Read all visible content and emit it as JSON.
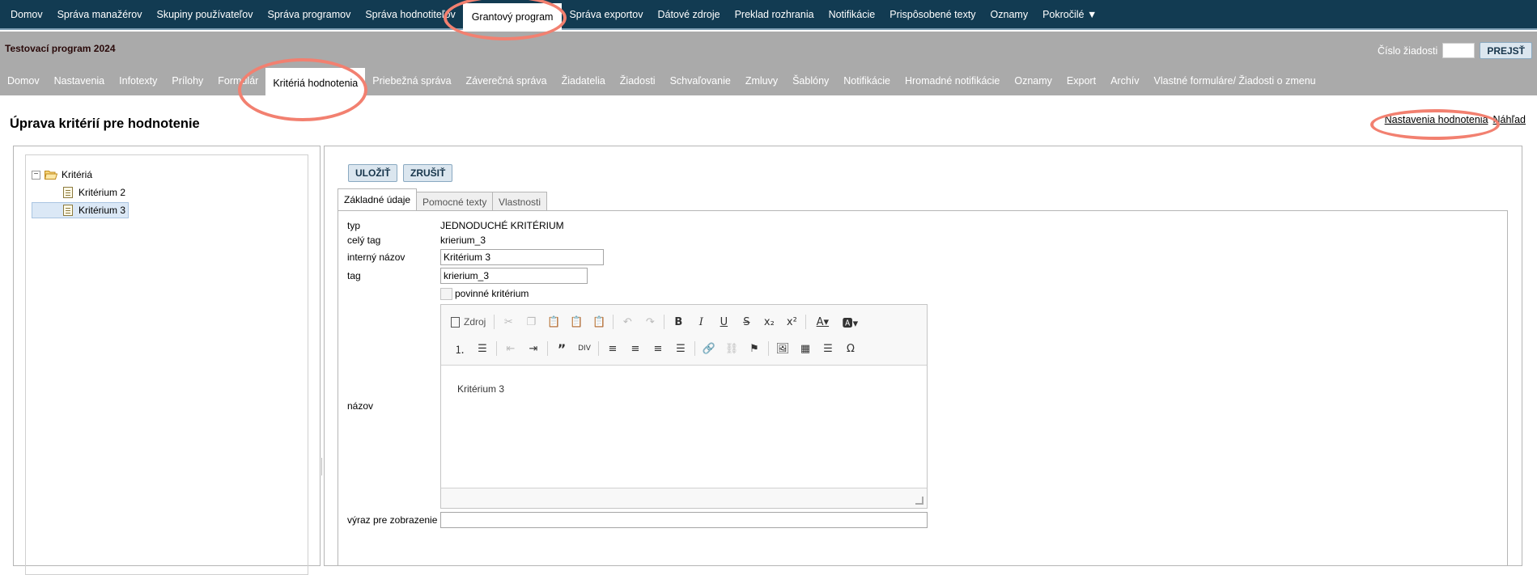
{
  "topnav": {
    "items": [
      "Domov",
      "Správa manažérov",
      "Skupiny používateľov",
      "Správa programov",
      "Správa hodnotiteľov",
      "Grantový program",
      "Správa exportov",
      "Dátové zdroje",
      "Preklad rozhrania",
      "Notifikácie",
      "Prispôsobené texty",
      "Oznamy",
      "Pokročilé ▼"
    ],
    "active": "Grantový program"
  },
  "program": {
    "title": "Testovací program 2024",
    "request_label": "Číslo žiadosti",
    "request_value": "",
    "go_button": "PREJSŤ"
  },
  "subnav": {
    "items": [
      "Domov",
      "Nastavenia",
      "Infotexty",
      "Prílohy",
      "Formulár",
      "Kritériá hodnotenia",
      "Priebežná správa",
      "Záverečná správa",
      "Žiadatelia",
      "Žiadosti",
      "Schvaľovanie",
      "Zmluvy",
      "Šablóny",
      "Notifikácie",
      "Hromadné notifikácie",
      "Oznamy",
      "Export",
      "Archív",
      "Vlastné formuláre/ Žiadosti o zmenu"
    ],
    "active": "Kritériá hodnotenia"
  },
  "page": {
    "title": "Úprava kritérií pre hodnotenie",
    "link_settings": "Nastavenia hodnotenia",
    "link_preview": "Náhľad"
  },
  "tree": {
    "root": "Kritériá",
    "root_toggle": "−",
    "children": [
      "Kritérium 2",
      "Kritérium 3"
    ],
    "selected": "Kritérium 3"
  },
  "actions": {
    "save": "ULOŽIŤ",
    "cancel": "ZRUŠIŤ"
  },
  "tabs": [
    "Základné údaje",
    "Pomocné texty",
    "Vlastnosti"
  ],
  "form": {
    "type_label": "typ",
    "type_value": "JEDNODUCHÉ KRITÉRIUM",
    "fulltag_label": "celý tag",
    "fulltag_value": "krierium_3",
    "internal_label": "interný názov",
    "internal_value": "Kritérium 3",
    "tag_label": "tag",
    "tag_value": "krierium_3",
    "mandatory_label": "povinné kritérium",
    "mandatory_checked": false,
    "name_label": "názov",
    "name_value": "Kritérium 3",
    "display_expr_label": "výraz pre zobrazenie",
    "display_expr_value": ""
  },
  "editor": {
    "source_label": "Zdroj",
    "toolbar_row1": [
      "cut-icon",
      "copy-icon",
      "paste-icon",
      "paste-text-icon",
      "paste-word-icon",
      "undo-icon",
      "redo-icon",
      "bold-icon",
      "italic-icon",
      "underline-icon",
      "strike-icon",
      "subscript-icon",
      "superscript-icon",
      "text-color-icon",
      "bg-color-icon"
    ],
    "toolbar_row2": [
      "numbered-list-icon",
      "bullet-list-icon",
      "outdent-icon",
      "indent-icon",
      "blockquote-icon",
      "div-icon",
      "align-left-icon",
      "align-center-icon",
      "align-right-icon",
      "justify-icon",
      "link-icon",
      "unlink-icon",
      "anchor-icon",
      "image-icon",
      "table-icon",
      "horizontal-rule-icon",
      "special-char-icon"
    ]
  },
  "colors": {
    "topnav_bg": "#123b52",
    "subnav_bg": "#aaaaaa",
    "button_bg": "#dbe6ef",
    "highlight": "#f28070"
  }
}
